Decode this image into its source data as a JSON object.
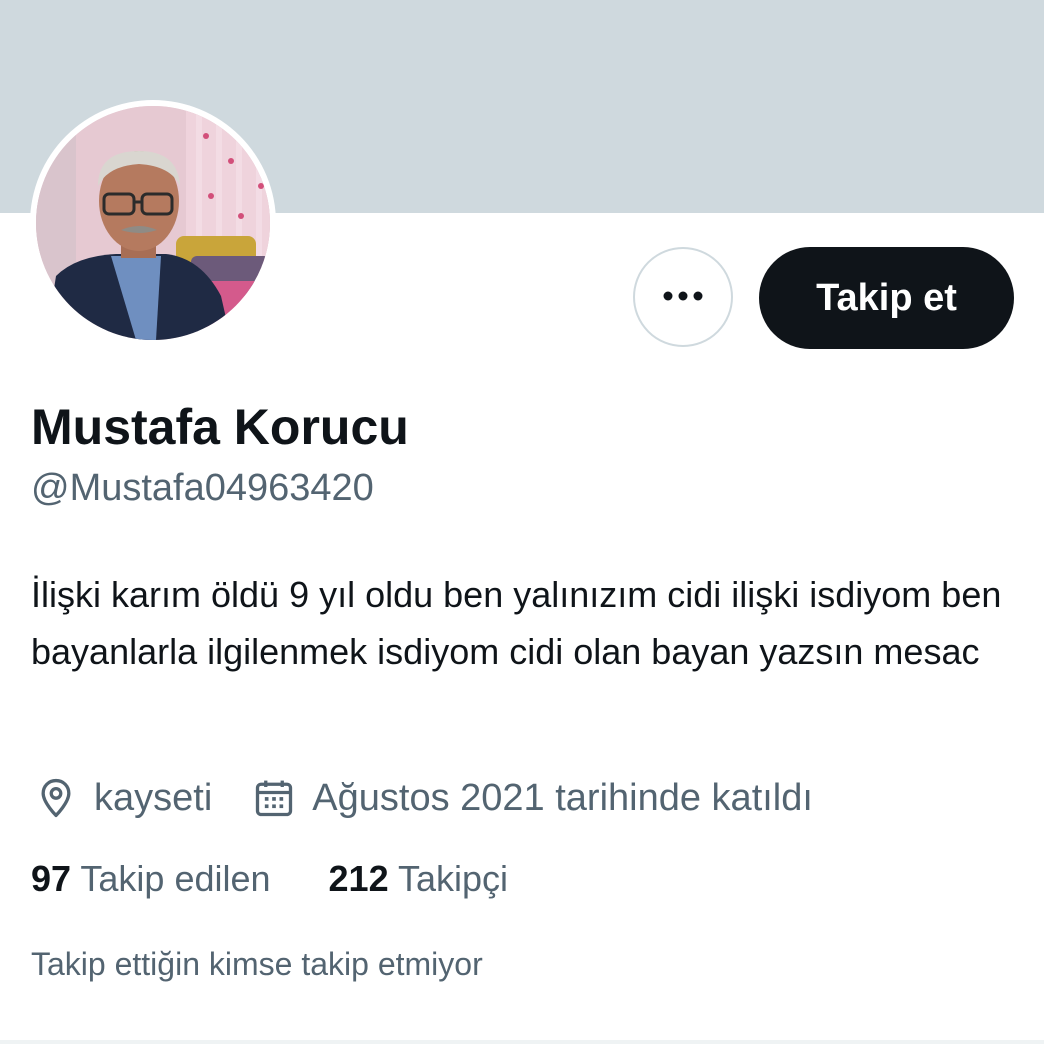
{
  "profile": {
    "name": "Mustafa Korucu",
    "handle": "@Mustafa04963420",
    "bio": "İlişki karım öldü 9 yıl oldu ben yalınızım cidi ilişki isdiyom ben bayanlarla ilgilenmek isdiyom cidi olan bayan yazsın mesac",
    "location": "kayseti",
    "joined": "Ağustos 2021 tarihinde katıldı"
  },
  "actions": {
    "more_icon": "more-horizontal-icon",
    "follow_label": "Takip et"
  },
  "stats": {
    "following_count": "97",
    "following_label": "Takip edilen",
    "followers_count": "212",
    "followers_label": "Takipçi"
  },
  "mutuals_text": "Takip ettiğin kimse takip etmiyor",
  "icons": {
    "location": "map-pin-icon",
    "joined": "calendar-icon"
  },
  "colors": {
    "banner": "#cfd9de",
    "primary_text": "#0f1419",
    "secondary_text": "#536471",
    "follow_button_bg": "#0f1419",
    "follow_button_text": "#ffffff"
  }
}
